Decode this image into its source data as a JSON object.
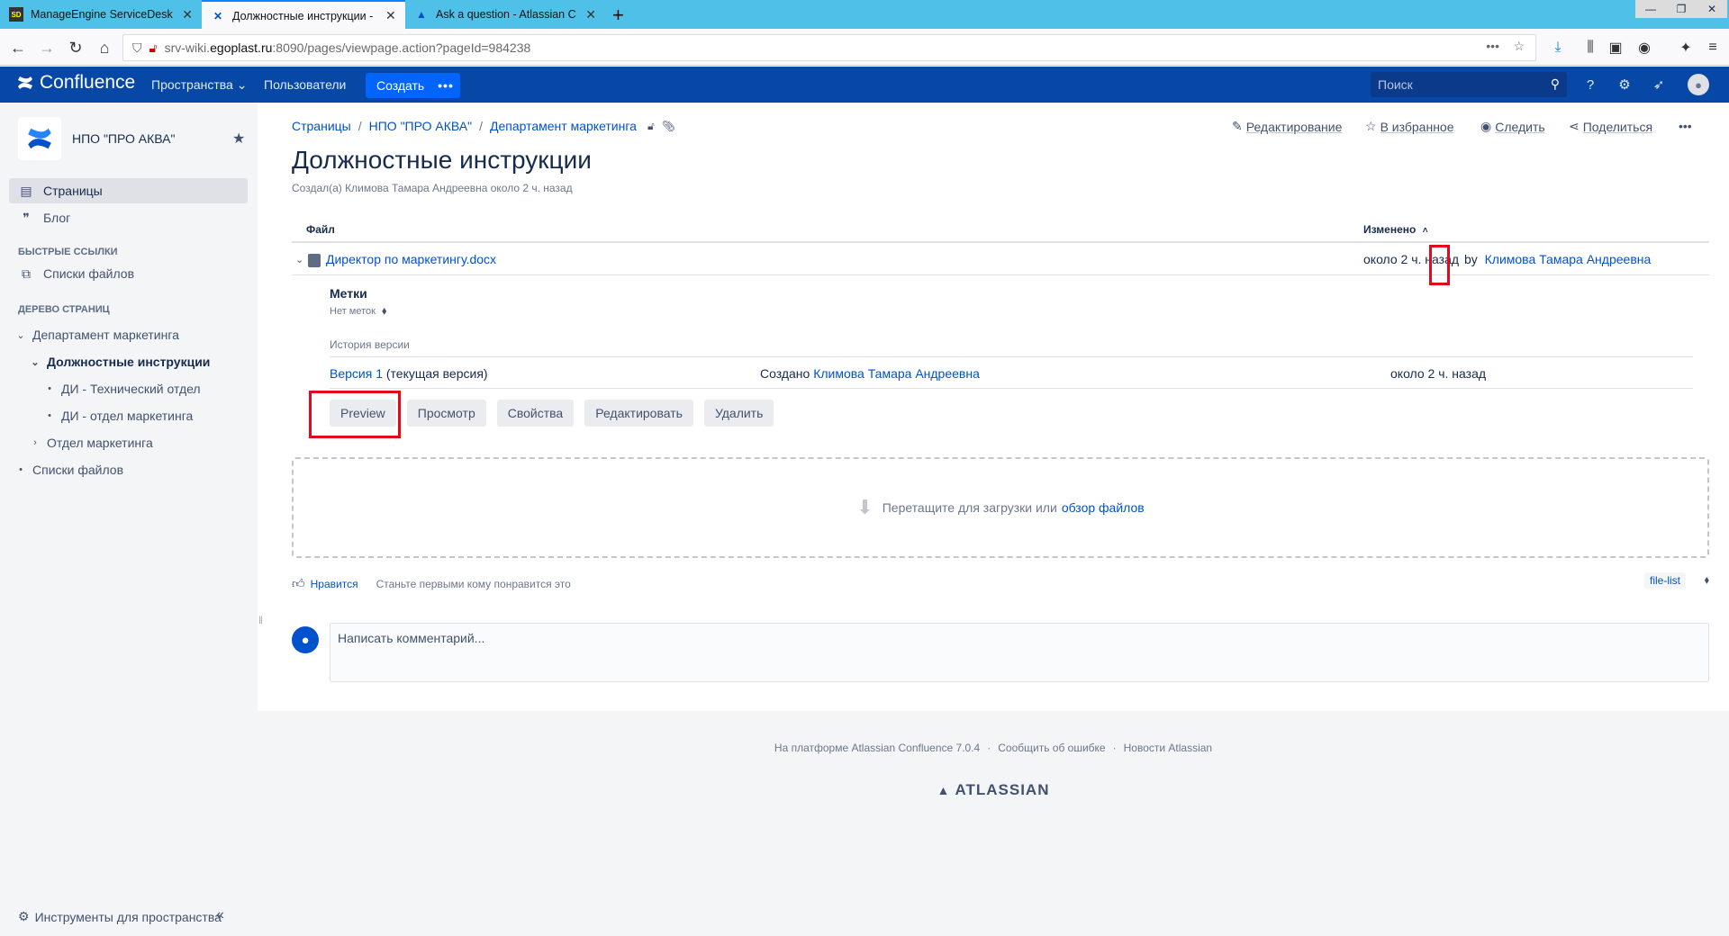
{
  "browser": {
    "tabs": [
      {
        "title": "ManageEngine ServiceDesk Plus",
        "icon": "SD"
      },
      {
        "title": "Должностные инструкции - НПО \"ПРО АКВА\"",
        "icon": "confluence"
      },
      {
        "title": "Ask a question - Atlassian Community",
        "icon": "atlassian"
      }
    ],
    "new_tab": "+",
    "url_prefix": "srv-wiki.",
    "url_host": "egoplast.ru",
    "url_rest": ":8090/pages/viewpage.action?pageId=984238"
  },
  "header": {
    "product": "Confluence",
    "spaces": "Пространства",
    "people": "Пользователи",
    "create": "Создать",
    "more": "•••",
    "search_placeholder": "Поиск"
  },
  "sidebar": {
    "space_name": "НПО \"ПРО АКВА\"",
    "nav": [
      {
        "label": "Страницы",
        "icon": "pages-icon"
      },
      {
        "label": "Блог",
        "icon": "blog-icon"
      }
    ],
    "quick_links_title": "БЫСТРЫЕ ССЫЛКИ",
    "quick_links": [
      {
        "label": "Списки файлов"
      }
    ],
    "tree_title": "ДЕРЕВО СТРАНИЦ",
    "tree": [
      {
        "label": "Департамент маркетинга"
      },
      {
        "label": "Должностные инструкции"
      },
      {
        "label": "ДИ - Технический отдел"
      },
      {
        "label": "ДИ - отдел маркетинга"
      },
      {
        "label": "Отдел маркетинга"
      },
      {
        "label": "Списки файлов"
      }
    ],
    "tools": "Инструменты для пространства",
    "collapse": "«"
  },
  "page": {
    "breadcrumbs": [
      "Страницы",
      "НПО \"ПРО АКВА\"",
      "Департамент маркетинга"
    ],
    "actions": {
      "edit": "Редактирование",
      "favourite": "В избранное",
      "watch": "Следить",
      "share": "Поделиться",
      "more": "•••"
    },
    "title": "Должностные инструкции",
    "meta": "Создал(а) Климова Тамара Андреевна около 2 ч. назад",
    "table": {
      "col_file": "Файл",
      "col_modified": "Изменено",
      "sort_arrow": "˄"
    },
    "file": {
      "name": "Директор по маркетингу.docx",
      "modified_time": "около 2 ч. назад",
      "by": "by",
      "author": "Климова Тамара Андреевна"
    },
    "labels_title": "Метки",
    "labels_none": "Нет меток",
    "version_history_title": "История версии",
    "version": {
      "name": "Версия 1",
      "current": "(текущая версия)",
      "created_prefix": "Создано",
      "author": "Климова Тамара Андреевна",
      "time": "около 2 ч. назад"
    },
    "buttons": {
      "preview": "Preview",
      "view": "Просмотр",
      "properties": "Свойства",
      "edit": "Редактировать",
      "delete": "Удалить"
    },
    "dropzone": {
      "text": "Перетащите для загрузки или",
      "link": "обзор файлов"
    },
    "like": {
      "link": "Нравится",
      "text": "Станьте первыми кому понравится это"
    },
    "label_chip": "file-list",
    "comment_placeholder": "Написать комментарий..."
  },
  "footer": {
    "powered": "На платформе Atlassian Confluence 7.0.4",
    "report": "Сообщить об ошибке",
    "news": "Новости Atlassian",
    "brand": "ATLASSIAN"
  },
  "colors": {
    "header_bg": "#0747a6",
    "create_btn": "#0065ff",
    "link": "#0052cc",
    "highlight": "#e2091d",
    "tabstrip": "#4fc1e9"
  }
}
